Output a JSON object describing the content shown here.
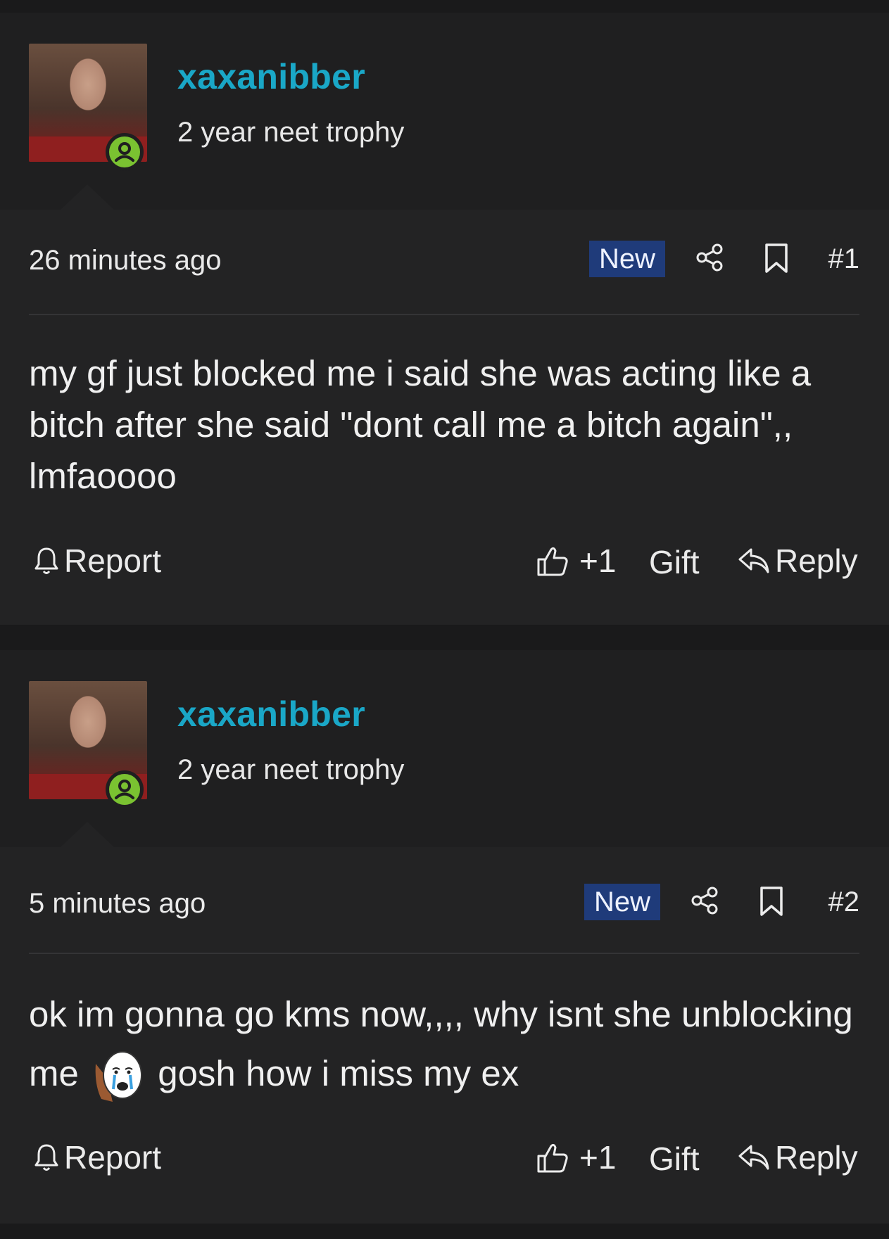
{
  "posts": [
    {
      "username": "xaxanibber",
      "user_title": "2 year neet trophy",
      "timestamp": "26 minutes ago",
      "badge": "New",
      "post_number": "#1",
      "message": "my gf just blocked me i said she was acting like a bitch after she said \"dont call me a bitch again\",, lmfaoooo",
      "message_after_emoji": "",
      "actions": {
        "report": "Report",
        "like": "+1",
        "gift": "Gift",
        "reply": "Reply"
      }
    },
    {
      "username": "xaxanibber",
      "user_title": "2 year neet trophy",
      "timestamp": "5 minutes ago",
      "badge": "New",
      "post_number": "#2",
      "message": "ok im gonna go kms now,,,, why isnt she unblocking me",
      "emoji": "crying-wojak-emoji",
      "message_after_emoji": "gosh how i miss my ex",
      "actions": {
        "report": "Report",
        "like": "+1",
        "gift": "Gift",
        "reply": "Reply"
      }
    }
  ],
  "colors": {
    "username": "#1aa7c7",
    "badge_bg": "#1f3b7a",
    "online": "#7ac231",
    "background": "#232324"
  }
}
